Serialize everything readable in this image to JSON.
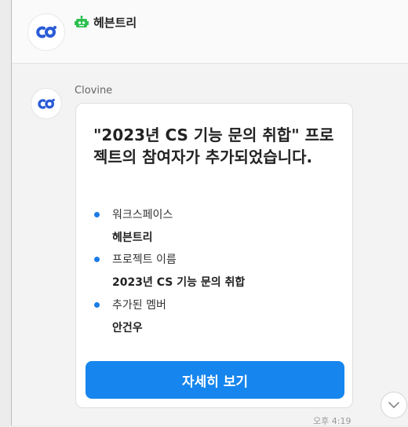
{
  "header": {
    "workspace_name": "헤븐트리"
  },
  "message": {
    "sender": "Clovine",
    "title": "\"2023년 CS 기능 문의 취합\" 프로젝트의 참여자가 추가되었습니다.",
    "items": [
      {
        "label": "워크스페이스",
        "value": "헤븐트리"
      },
      {
        "label": "프로젝트 이름",
        "value": "2023년 CS 기능 문의 취합"
      },
      {
        "label": "추가된 멤버",
        "value": "안건우"
      }
    ],
    "button_label": "자세히 보기",
    "time": "오후 4:19"
  },
  "colors": {
    "accent": "#1686ee",
    "bullet": "#1a7be6",
    "robot": "#2ec04f",
    "logo": "#2a5bd7"
  },
  "icons": {
    "logo": "clovine-logo-icon",
    "robot": "robot-icon",
    "scroll": "chevron-down-icon"
  }
}
